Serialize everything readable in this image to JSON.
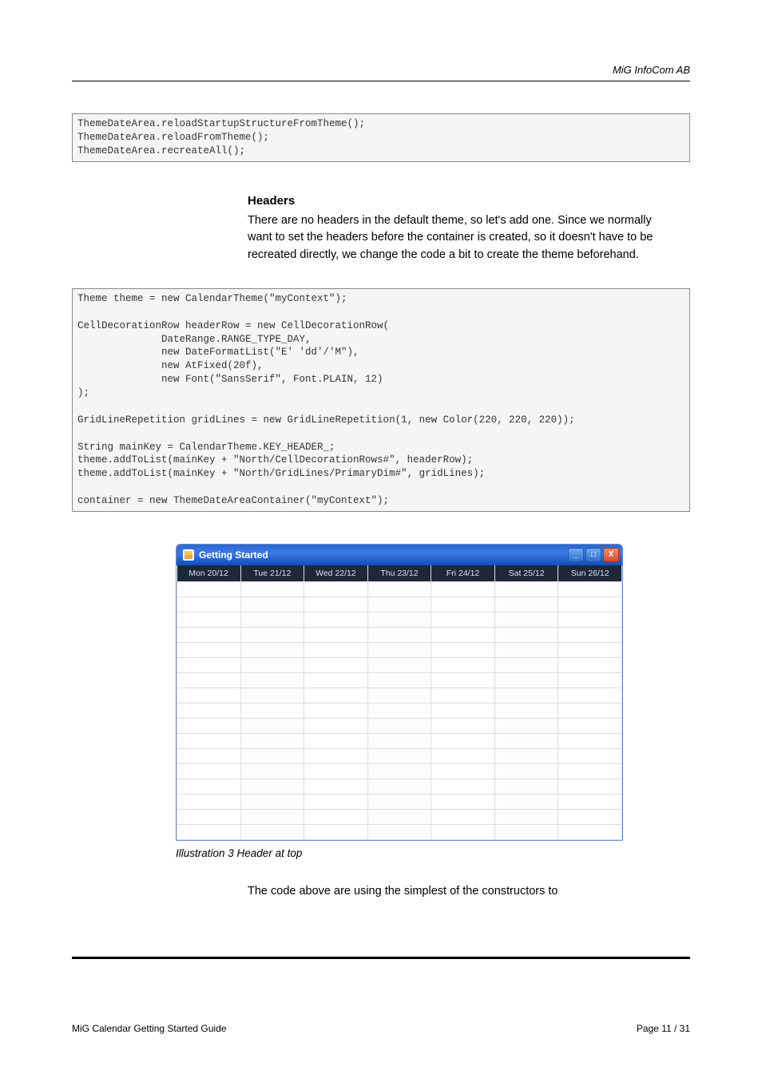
{
  "header": {
    "company": "MiG InfoCom AB"
  },
  "code1": "ThemeDateArea.reloadStartupStructureFromTheme();\nThemeDateArea.reloadFromTheme();\nThemeDateArea.recreateAll();",
  "section": {
    "heading": "Headers",
    "paragraph": "There are no headers in the default theme, so let's add one. Since we normally want to set the headers before the container is created, so it doesn't have to be recreated directly, we change the code a bit to create the theme beforehand."
  },
  "code2": "Theme theme = new CalendarTheme(\"myContext\");\n\nCellDecorationRow headerRow = new CellDecorationRow(\n              DateRange.RANGE_TYPE_DAY,\n              new DateFormatList(\"E' 'dd'/'M\"),\n              new AtFixed(20f),\n              new Font(\"SansSerif\", Font.PLAIN, 12)\n);\n\nGridLineRepetition gridLines = new GridLineRepetition(1, new Color(220, 220, 220));\n\nString mainKey = CalendarTheme.KEY_HEADER_;\ntheme.addToList(mainKey + \"North/CellDecorationRows#\", headerRow);\ntheme.addToList(mainKey + \"North/GridLines/PrimaryDim#\", gridLines);\n\ncontainer = new ThemeDateAreaContainer(\"myContext\");",
  "window": {
    "title": "Getting Started",
    "days": [
      "Mon 20/12",
      "Tue 21/12",
      "Wed 22/12",
      "Thu 23/12",
      "Fri 24/12",
      "Sat 25/12",
      "Sun 26/12"
    ]
  },
  "caption": "Illustration 3 Header at top",
  "after_para": "The code above are using the simplest of the constructors to",
  "footer": {
    "left": "MiG Calendar Getting Started Guide",
    "right": "Page 11 / 31"
  }
}
